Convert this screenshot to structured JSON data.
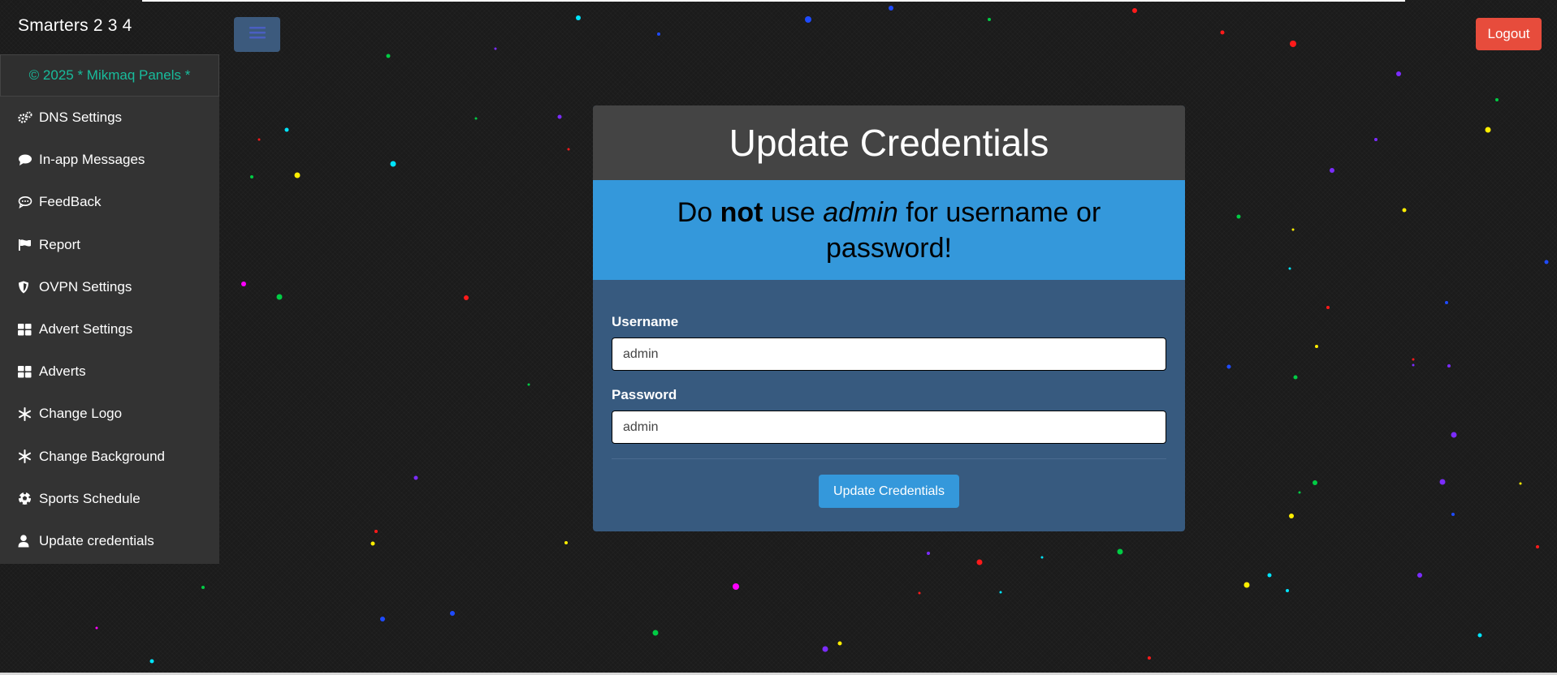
{
  "navbar": {
    "brand": "Smarters 2 3 4",
    "toggle_icon": "bars-icon",
    "logout_label": "Logout",
    "logout_color": "#e74c3c"
  },
  "sidebar": {
    "copyright": "© 2025 *  Mikmaq Panels  *",
    "items": [
      {
        "label": "DNS Settings",
        "icon": "cogs-icon"
      },
      {
        "label": "In-app Messages",
        "icon": "comment-icon"
      },
      {
        "label": "FeedBack",
        "icon": "comment-dots-icon"
      },
      {
        "label": "Report",
        "icon": "flag-icon"
      },
      {
        "label": "OVPN Settings",
        "icon": "shield-icon"
      },
      {
        "label": "Advert Settings",
        "icon": "grid-icon"
      },
      {
        "label": "Adverts",
        "icon": "grid-icon"
      },
      {
        "label": "Change Logo",
        "icon": "snowflake-icon"
      },
      {
        "label": "Change Background",
        "icon": "snowflake-icon"
      },
      {
        "label": "Sports Schedule",
        "icon": "soccer-ball-icon"
      },
      {
        "label": "Update credentials",
        "icon": "user-icon"
      }
    ]
  },
  "panel": {
    "title": "Update Credentials",
    "warning": {
      "part1": "Do ",
      "bold": "not",
      "part2": " use ",
      "italic": "admin",
      "part3": " for username or password!"
    },
    "username_label": "Username",
    "username_value": "admin",
    "password_label": "Password",
    "password_value": "admin",
    "submit_label": "Update Credentials"
  },
  "colors": {
    "panel_body": "#375a7f",
    "panel_heading": "#444444",
    "alert": "#3498db",
    "accent_green": "#18bc9c",
    "sidebar": "#333333"
  }
}
